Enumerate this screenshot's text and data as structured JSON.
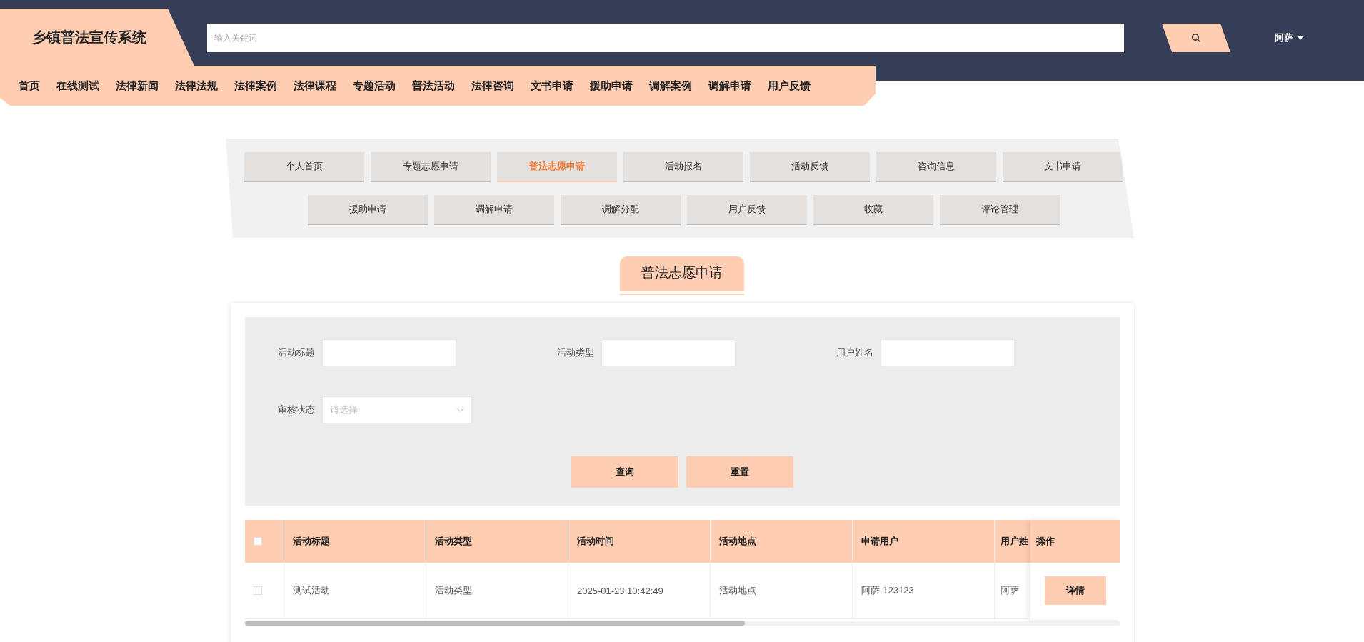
{
  "header": {
    "title": "乡镇普法宣传系统",
    "search": {
      "placeholder": "输入关键词"
    },
    "user": "阿萨"
  },
  "nav": [
    "首页",
    "在线测试",
    "法律新闻",
    "法律法规",
    "法律案例",
    "法律课程",
    "专题活动",
    "普法活动",
    "法律咨询",
    "文书申请",
    "援助申请",
    "调解案例",
    "调解申请",
    "用户反馈"
  ],
  "center_tabs": [
    {
      "label": "个人首页",
      "selected": false
    },
    {
      "label": "专题志愿申请",
      "selected": false
    },
    {
      "label": "普法志愿申请",
      "selected": true
    },
    {
      "label": "活动报名",
      "selected": false
    },
    {
      "label": "活动反馈",
      "selected": false
    },
    {
      "label": "咨询信息",
      "selected": false
    },
    {
      "label": "文书申请",
      "selected": false
    },
    {
      "label": "援助申请",
      "selected": false
    },
    {
      "label": "调解申请",
      "selected": false
    },
    {
      "label": "调解分配",
      "selected": false
    },
    {
      "label": "用户反馈",
      "selected": false
    },
    {
      "label": "收藏",
      "selected": false
    },
    {
      "label": "评论管理",
      "selected": false
    }
  ],
  "page_title": "普法志愿申请",
  "filters": [
    {
      "label": "活动标题",
      "kind": "text"
    },
    {
      "label": "活动类型",
      "kind": "text"
    },
    {
      "label": "用户姓名",
      "kind": "text"
    },
    {
      "label": "审核状态",
      "kind": "select",
      "placeholder": "请选择"
    }
  ],
  "filter_buttons": [
    "查询",
    "重置"
  ],
  "table": {
    "select_all_checked": false,
    "columns": [
      "活动标题",
      "活动类型",
      "活动时间",
      "活动地点",
      "申请用户",
      "用户姓"
    ],
    "action_column": "操作",
    "rows": [
      {
        "checked": false,
        "cells": [
          "测试活动",
          "活动类型",
          "2025-01-23 10:42:49",
          "活动地点",
          "阿萨-123123",
          "阿萨"
        ],
        "action": "详情"
      }
    ]
  }
}
